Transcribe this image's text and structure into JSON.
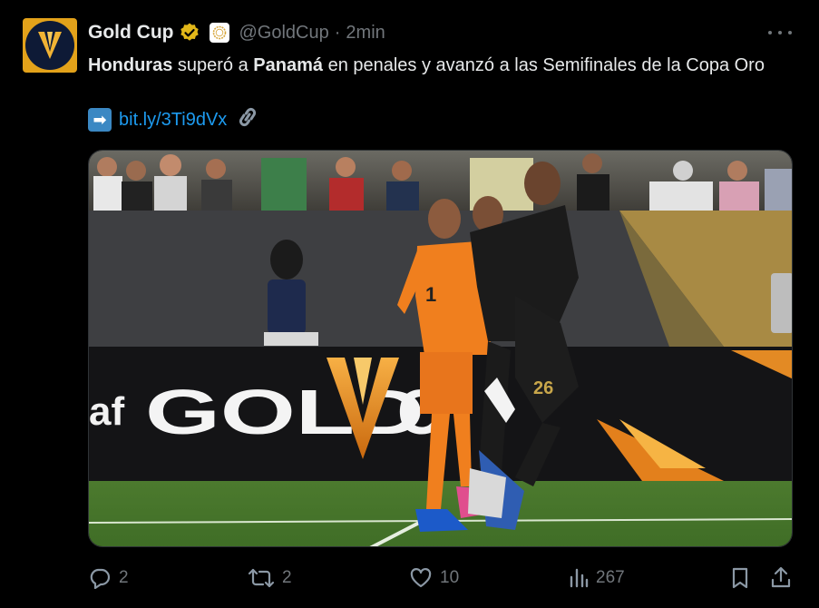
{
  "account": {
    "name": "Gold Cup",
    "handle": "@GoldCup",
    "separator": "·",
    "time": "2min"
  },
  "tweet": {
    "team1": "Honduras",
    "text_mid": " superó a ",
    "team2": "Panamá",
    "text_end": " en penales y avanzó a las Semifinales de la Copa Oro",
    "link": "bit.ly/3Ti9dVx"
  },
  "media": {
    "board_text": "GOLD C",
    "board_prefix": "af",
    "keeper_number": "1",
    "player_number": "26",
    "official_text": "CAF"
  },
  "actions": {
    "replies": "2",
    "reposts": "2",
    "likes": "10",
    "views": "267"
  },
  "colors": {
    "accent": "#1d9bf0",
    "gold": "#e3a21a",
    "muted": "#71767b",
    "background": "#000000"
  }
}
